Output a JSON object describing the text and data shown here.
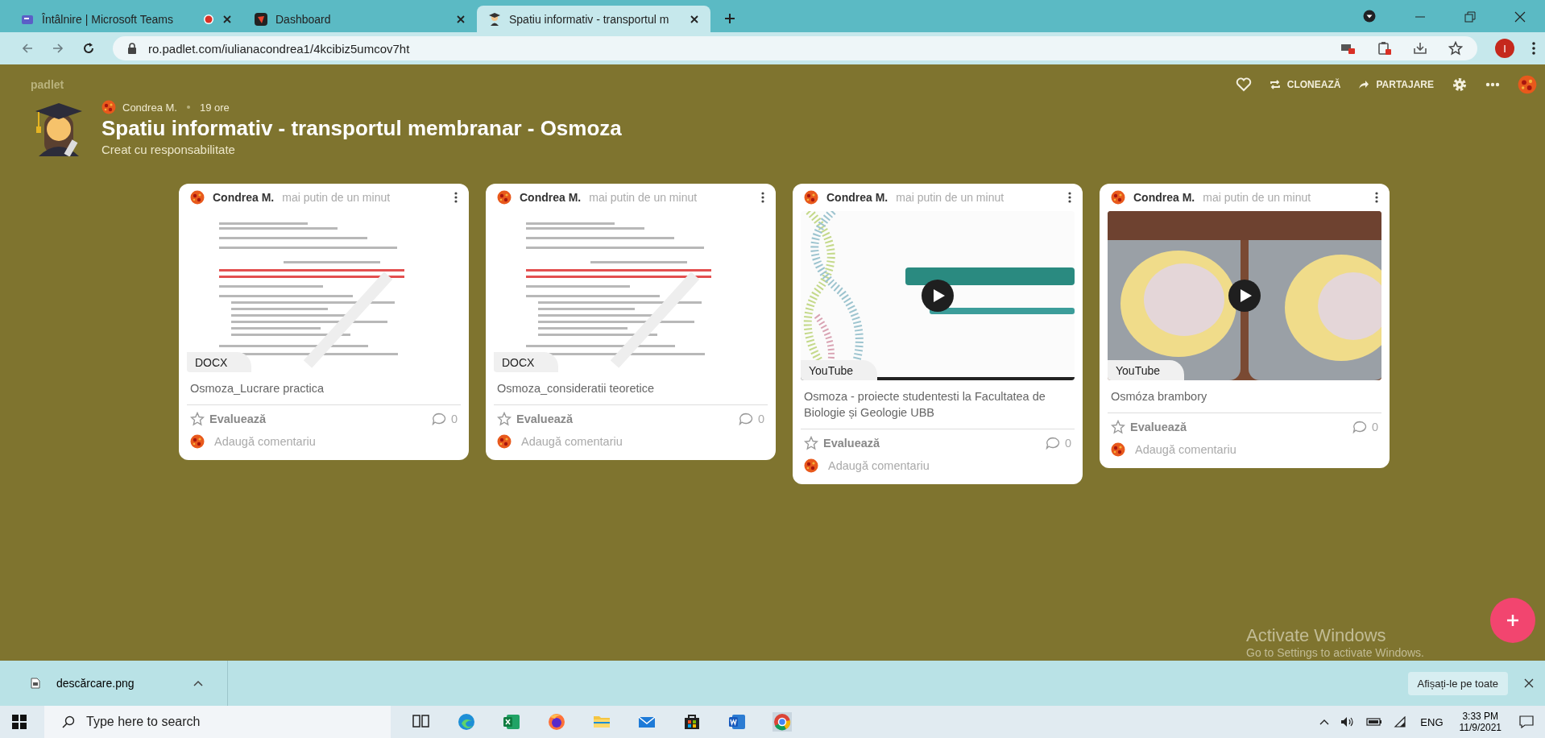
{
  "browser": {
    "tabs": [
      {
        "title": "Întâlnire | Microsoft Teams",
        "selected": false,
        "recording": true
      },
      {
        "title": "Dashboard",
        "selected": false,
        "recording": false
      },
      {
        "title": "Spatiu informativ - transportul m",
        "selected": true,
        "recording": false
      }
    ],
    "url": "ro.padlet.com/iulianacondrea1/4kcibiz5umcov7ht",
    "profile_initial": "I"
  },
  "padlet": {
    "brand": "padlet",
    "actions": [
      {
        "kind": "like"
      },
      {
        "kind": "clone",
        "label": "CLONEAZĂ"
      },
      {
        "kind": "share",
        "label": "PARTAJARE"
      },
      {
        "kind": "settings"
      },
      {
        "kind": "more"
      }
    ],
    "author": "Condrea M.",
    "age": "19 ore",
    "title": "Spatiu informativ - transportul membranar - Osmoza",
    "subtitle": "Creat cu responsabilitate",
    "posts": [
      {
        "author": "Condrea M.",
        "time": "mai putin de un minut",
        "kind": "doc",
        "attachment": "DOCX",
        "caption": "Osmoza_Lucrare practica",
        "rate": "Evaluează",
        "comments": "0",
        "comment_prompt": "Adaugă comentariu"
      },
      {
        "author": "Condrea M.",
        "time": "mai putin de un minut",
        "kind": "doc",
        "attachment": "DOCX",
        "caption": "Osmoza_consideratii teoretice",
        "rate": "Evaluează",
        "comments": "0",
        "comment_prompt": "Adaugă comentariu"
      },
      {
        "author": "Condrea M.",
        "time": "mai putin de un minut",
        "kind": "video",
        "attachment": "YouTube",
        "caption": "Osmoza - proiecte studentesti la Facultatea de Biologie și Geologie UBB",
        "rate": "Evaluează",
        "comments": "0",
        "comment_prompt": "Adaugă comentariu"
      },
      {
        "author": "Condrea M.",
        "time": "mai putin de un minut",
        "kind": "video",
        "attachment": "YouTube",
        "caption": "Osmóza brambory",
        "rate": "Evaluează",
        "comments": "0",
        "comment_prompt": "Adaugă comentariu"
      }
    ]
  },
  "activation": {
    "title": "Activate Windows",
    "hint": "Go to Settings to activate Windows."
  },
  "downloads": {
    "file": "descărcare.png",
    "show_all": "Afișați-le pe toate"
  },
  "taskbar": {
    "search_placeholder": "Type here to search",
    "language": "ENG",
    "time": "3:33 PM",
    "date": "11/9/2021"
  }
}
